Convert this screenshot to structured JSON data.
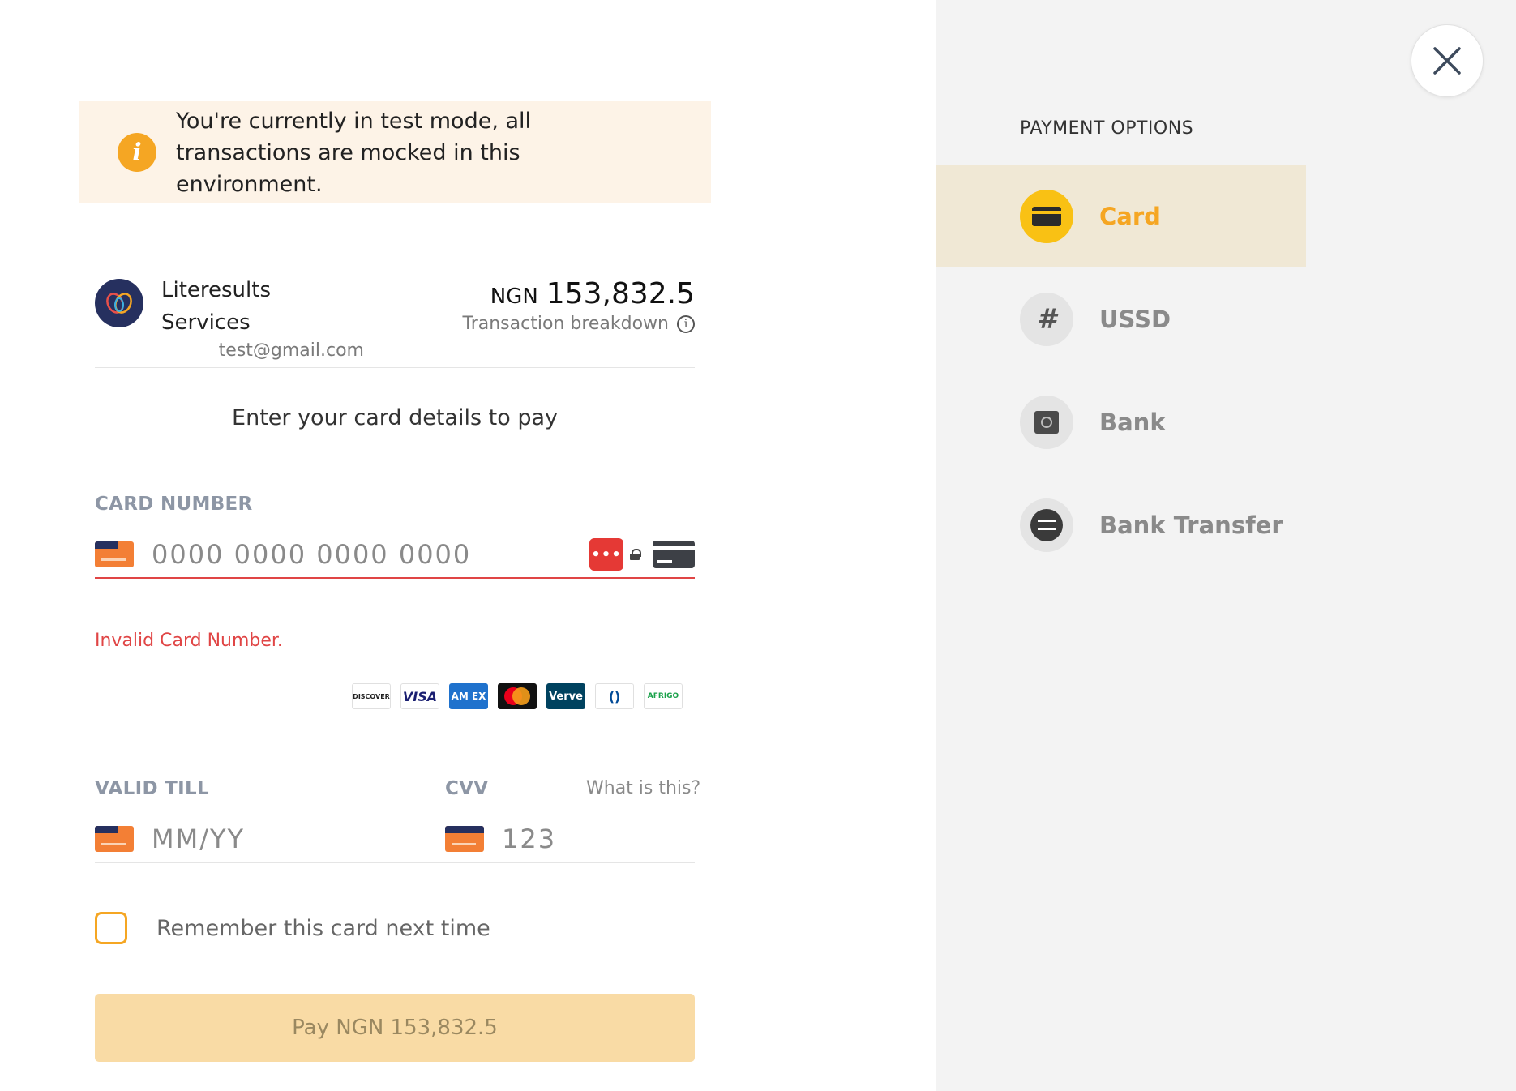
{
  "banner": {
    "text": "You're currently in test mode, all transactions are mocked in this environment.",
    "icon": "info-icon",
    "icon_glyph": "i"
  },
  "merchant": {
    "name": "Literesults Services",
    "email": "test@gmail.com",
    "logo": "merchant-logo-icon"
  },
  "amount": {
    "currency": "NGN",
    "value": "153,832.5",
    "breakdown_label": "Transaction breakdown",
    "breakdown_icon_glyph": "i"
  },
  "form": {
    "subtitle": "Enter your card details to pay",
    "card_number_label": "CARD NUMBER",
    "card_number_placeholder": "0000 0000 0000 0000",
    "card_number_value": "",
    "password_manager_glyph": "•••",
    "error": "Invalid Card Number.",
    "valid_till_label": "VALID TILL",
    "valid_till_placeholder": "MM/YY",
    "cvv_label": "CVV",
    "cvv_placeholder": "123",
    "what_is_this": "What is this?",
    "remember_label": "Remember this card next time",
    "remember_checked": false,
    "pay_button": "Pay NGN 153,832.5"
  },
  "card_brands": [
    {
      "name": "discover",
      "label": "DISCOVER"
    },
    {
      "name": "visa",
      "label": "VISA"
    },
    {
      "name": "amex",
      "label": "AM EX"
    },
    {
      "name": "mastercard",
      "label": ""
    },
    {
      "name": "verve",
      "label": "Verve"
    },
    {
      "name": "diners",
      "label": "()"
    },
    {
      "name": "afrigo",
      "label": "AFRIGO"
    }
  ],
  "payment_options": {
    "title": "PAYMENT OPTIONS",
    "items": [
      {
        "label": "Card",
        "icon": "card-icon",
        "active": true
      },
      {
        "label": "USSD",
        "icon": "hash-icon",
        "glyph": "#",
        "active": false
      },
      {
        "label": "Bank",
        "icon": "bank-safe-icon",
        "active": false
      },
      {
        "label": "Bank Transfer",
        "icon": "transfer-icon",
        "active": false
      }
    ]
  },
  "colors": {
    "accent": "#f5a623",
    "error": "#e04545",
    "banner_bg": "#fdf3e7",
    "sidebar_bg": "#f3f3f3",
    "active_option_bg": "#f0e8d5",
    "pay_button_bg": "#f9dba5"
  }
}
